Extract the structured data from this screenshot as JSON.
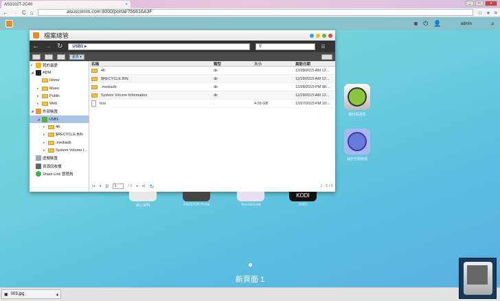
{
  "browser": {
    "tab_title": "AS3102T-2C40",
    "url": ".asuscomm.com:8000/portal/?56816A3F"
  },
  "portal": {
    "user": "admin"
  },
  "file_manager": {
    "title": "檔案總管",
    "path": "USB1",
    "more_label": "更多",
    "sidebar": [
      {
        "label": "我的最愛",
        "level": 0,
        "icon": "star-icon"
      },
      {
        "label": "ADM",
        "level": 0,
        "icon": "server-icon"
      },
      {
        "label": "Home",
        "level": 1,
        "icon": "folder-icon"
      },
      {
        "label": "Music",
        "level": 1,
        "icon": "folder-icon"
      },
      {
        "label": "Public",
        "level": 1,
        "icon": "folder-icon"
      },
      {
        "label": "Web",
        "level": 1,
        "icon": "folder-icon"
      },
      {
        "label": "外部裝置",
        "level": 0,
        "icon": "external-device-icon"
      },
      {
        "label": "USB1",
        "level": 1,
        "icon": "usb-icon",
        "selected": true
      },
      {
        "label": "4K",
        "level": 2,
        "icon": "folder-icon"
      },
      {
        "label": "$RECYCLE.BIN",
        "level": 2,
        "icon": "folder-icon"
      },
      {
        "label": ".mediadb",
        "level": 2,
        "icon": "folder-icon"
      },
      {
        "label": "System Volume I...",
        "level": 2,
        "icon": "folder-icon"
      },
      {
        "label": "虛擬裝置",
        "level": 0,
        "icon": "virtual-drive-icon"
      },
      {
        "label": "資源回收桶",
        "level": 0,
        "icon": "recycle-bin-icon"
      },
      {
        "label": "Share Link 管理員",
        "level": 0,
        "icon": "share-icon"
      }
    ],
    "columns": {
      "name": "名稱",
      "type": "類型",
      "size": "大小",
      "modified": "異動日期"
    },
    "files": [
      {
        "name": "4K",
        "type": "dir",
        "size": "",
        "modified": "12/28/2015 AM 12...",
        "icon": "folder"
      },
      {
        "name": "$RECYCLE.BIN",
        "type": "dir",
        "size": "",
        "modified": "12/28/2015 AM 12...",
        "icon": "folder"
      },
      {
        "name": ".mediadb",
        "type": "dir",
        "size": "",
        "modified": "12/28/2015 PM 08:...",
        "icon": "folder"
      },
      {
        "name": "System Volume Information",
        "type": "dir",
        "size": "",
        "modified": "12/28/2015 AM 12...",
        "icon": "folder"
      },
      {
        "name": "test",
        "type": ".",
        "size": "4.03 GB",
        "modified": "12/27/2015 PM 10:...",
        "icon": "file"
      }
    ],
    "pager": {
      "page_label": "頁",
      "page": "1",
      "total": "/ 1",
      "range": "1 - 5 / 5"
    }
  },
  "desktop": {
    "icons_right": [
      {
        "label": "備份與還原"
      },
      {
        "label": "儲存空間管理"
      }
    ],
    "icons_bottom": [
      {
        "label": "線上說明"
      },
      {
        "label": "ASUSTOR Portal"
      },
      {
        "label": "SoundsGood"
      },
      {
        "label": "KODI"
      }
    ],
    "kodi_text": "KODI",
    "page_title": "新頁面 1"
  },
  "downloads": {
    "file": "003.jpg"
  }
}
